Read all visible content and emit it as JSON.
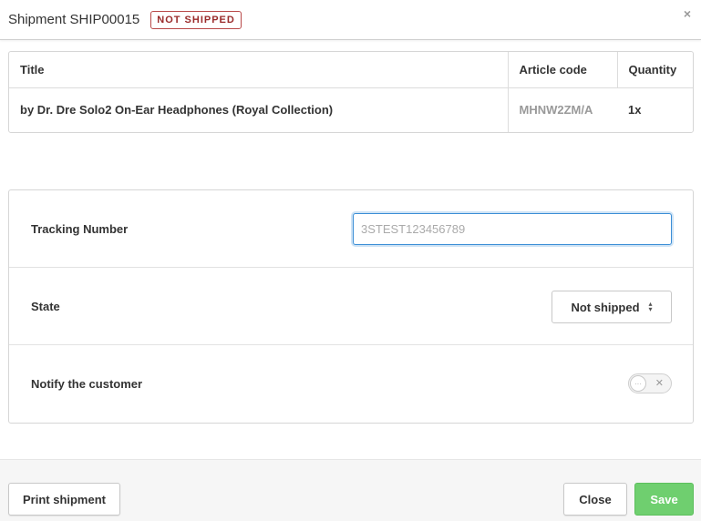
{
  "header": {
    "title": "Shipment SHIP00015",
    "status_badge": "NOT SHIPPED",
    "close_glyph": "×"
  },
  "items_table": {
    "columns": [
      "Title",
      "Article code",
      "Quantity"
    ],
    "rows": [
      {
        "title": "by Dr. Dre Solo2 On-Ear Headphones (Royal Collection)",
        "article_code": "MHNW2ZM/A",
        "quantity": "1x"
      }
    ]
  },
  "form": {
    "tracking_label": "Tracking Number",
    "tracking_value": "3STEST123456789",
    "state_label": "State",
    "state_value": "Not shipped",
    "notify_label": "Notify the customer",
    "notify_enabled": false
  },
  "footer": {
    "print_label": "Print shipment",
    "close_label": "Close",
    "save_label": "Save"
  },
  "colors": {
    "badge": "#9a2b2b",
    "focus": "#3b8ed6",
    "save": "#6fcf6f"
  }
}
